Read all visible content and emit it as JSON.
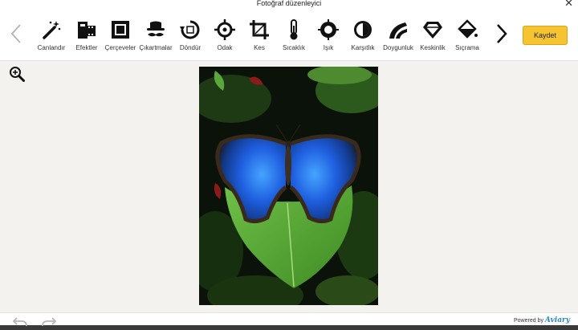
{
  "window": {
    "title": "Fotoğraf düzenleyici"
  },
  "toolbar": {
    "tools": [
      {
        "label": "Canlandır",
        "icon": "magic-wand-icon"
      },
      {
        "label": "Efektler",
        "icon": "film-effects-icon"
      },
      {
        "label": "Çerçeveler",
        "icon": "frame-icon"
      },
      {
        "label": "Çıkartmalar",
        "icon": "stickers-icon"
      },
      {
        "label": "Döndür",
        "icon": "rotate-icon"
      },
      {
        "label": "Odak",
        "icon": "focus-icon"
      },
      {
        "label": "Kes",
        "icon": "crop-icon"
      },
      {
        "label": "Sıcaklık",
        "icon": "thermometer-icon"
      },
      {
        "label": "Işık",
        "icon": "brightness-icon"
      },
      {
        "label": "Karşıtlık",
        "icon": "contrast-icon"
      },
      {
        "label": "Doygunluk",
        "icon": "saturation-icon"
      },
      {
        "label": "Keskinlik",
        "icon": "sharpness-icon"
      },
      {
        "label": "Sıçrama",
        "icon": "splash-icon"
      }
    ],
    "save_label": "Kaydet"
  },
  "footer": {
    "powered_by": "Powered by",
    "brand": "Aviary"
  },
  "colors": {
    "accent": "#f6c430",
    "brand": "#2a89c9"
  }
}
